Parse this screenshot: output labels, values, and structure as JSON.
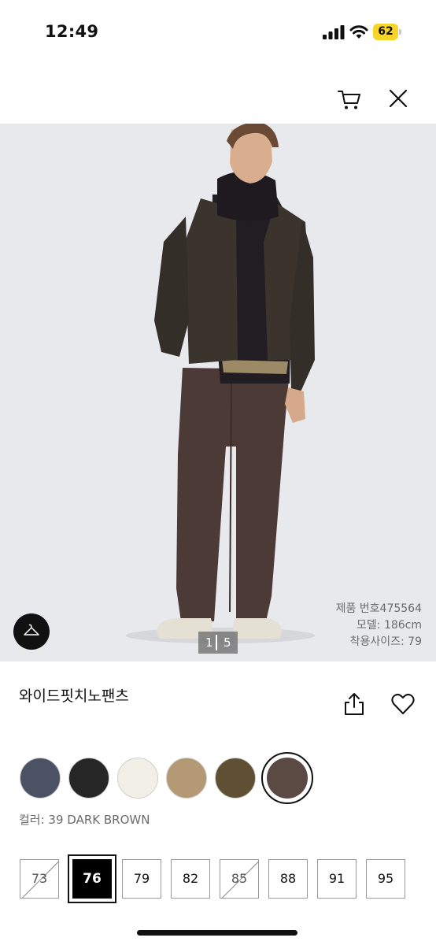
{
  "status_bar": {
    "time": "12:49",
    "battery": "62"
  },
  "nav": {
    "cart_icon": "cart-icon",
    "close_icon": "close-icon"
  },
  "hero": {
    "page_current": "1",
    "page_total": "5",
    "product_number": "제품 번호475564",
    "model_height": "모델: 186cm",
    "wear_size": "착용사이즈: 79"
  },
  "product": {
    "name": "와이드핏치노팬츠",
    "color_label": "컬러: 39 DARK BROWN"
  },
  "colors": [
    {
      "hex": "#4a5263",
      "selected": false
    },
    {
      "hex": "#262626",
      "selected": false
    },
    {
      "hex": "#f2efe6",
      "selected": false
    },
    {
      "hex": "#b39a74",
      "selected": false
    },
    {
      "hex": "#5f5033",
      "selected": false
    },
    {
      "hex": "#5a4a43",
      "selected": true
    }
  ],
  "sizes": [
    {
      "label": "73",
      "available": false,
      "selected": false
    },
    {
      "label": "76",
      "available": true,
      "selected": true
    },
    {
      "label": "79",
      "available": true,
      "selected": false
    },
    {
      "label": "82",
      "available": true,
      "selected": false
    },
    {
      "label": "85",
      "available": false,
      "selected": false
    },
    {
      "label": "88",
      "available": true,
      "selected": false
    },
    {
      "label": "91",
      "available": true,
      "selected": false
    },
    {
      "label": "95",
      "available": true,
      "selected": false
    }
  ]
}
